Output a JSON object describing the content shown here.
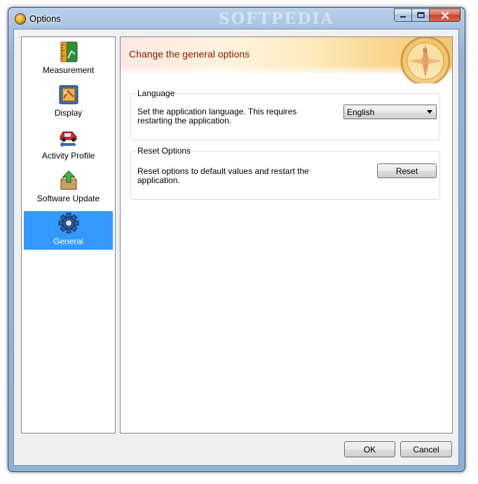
{
  "window": {
    "title": "Options",
    "watermark": "SOFTPEDIA"
  },
  "sidebar": {
    "items": [
      {
        "label": "Measurement",
        "icon": "ruler-icon",
        "selected": false
      },
      {
        "label": "Display",
        "icon": "display-icon",
        "selected": false
      },
      {
        "label": "Activity Profile",
        "icon": "car-wrench-icon",
        "selected": false
      },
      {
        "label": "Software Update",
        "icon": "update-box-icon",
        "selected": false
      },
      {
        "label": "General",
        "icon": "gear-icon",
        "selected": true
      }
    ]
  },
  "main": {
    "header": "Change the general options",
    "language_group": {
      "title": "Language",
      "description": "Set the application language. This requires restarting the application.",
      "selected_language": "English"
    },
    "reset_group": {
      "title": "Reset Options",
      "description": "Reset options to default values and restart the application.",
      "button_label": "Reset"
    }
  },
  "footer": {
    "ok_label": "OK",
    "cancel_label": "Cancel"
  },
  "colors": {
    "selection": "#3399ff",
    "header_text": "#8b1a00"
  }
}
